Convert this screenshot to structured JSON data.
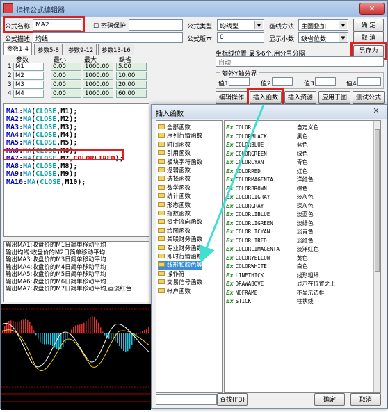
{
  "window": {
    "title": "指标公式编辑器",
    "close": "✕"
  },
  "form": {
    "name_label": "公式名称",
    "name_value": "MA2",
    "password_label": "密码保护",
    "type_label": "公式类型",
    "type_value": "均线型",
    "draw_label": "画线方法",
    "draw_value": "主图叠加",
    "ok": "确 定",
    "desc_label": "公式描述",
    "desc_value": "均线",
    "version_label": "公式版本",
    "version_value": "0",
    "decimal_label": "显示小数",
    "decimal_value": "缺省位数",
    "cancel": "取 消",
    "saveas": "另存为",
    "coord_label": "坐标线位置,最多6个,用分号分隔",
    "coord_value": "自动",
    "extra_axis_label": "额外Y轴分界",
    "values": [
      "值1",
      "值2",
      "值3",
      "值4"
    ],
    "btn_edit": "编辑操作",
    "btn_insert_func": "插入函数",
    "btn_insert_res": "插入资源",
    "btn_apply": "应用于图",
    "btn_test": "测试公式"
  },
  "tabs": [
    "参数1-4",
    "参数5-8",
    "参数9-12",
    "参数13-16"
  ],
  "params": {
    "headers": [
      "参数",
      "最小",
      "最大",
      "缺省"
    ],
    "rows": [
      {
        "idx": "1",
        "name": "M1",
        "min": "0.00",
        "max": "1000.00",
        "def": "5.00"
      },
      {
        "idx": "2",
        "name": "M2",
        "min": "0.00",
        "max": "1000.00",
        "def": "10.00"
      },
      {
        "idx": "3",
        "name": "M3",
        "min": "0.00",
        "max": "1000.00",
        "def": "20.00"
      },
      {
        "idx": "4",
        "name": "M4",
        "min": "0.00",
        "max": "1000.00",
        "def": "60.00"
      }
    ]
  },
  "code": [
    {
      "var": "MA1",
      "arg": "M1",
      "extra": ""
    },
    {
      "var": "MA2",
      "arg": "M2",
      "extra": ""
    },
    {
      "var": "MA3",
      "arg": "M3",
      "extra": ""
    },
    {
      "var": "MA4",
      "arg": "M4",
      "extra": ""
    },
    {
      "var": "MA5",
      "arg": "M5",
      "extra": ""
    },
    {
      "var": "MA6",
      "arg": "M6",
      "extra": ""
    },
    {
      "var": "MA7",
      "arg": "M7",
      "extra": ",COLORLIRED"
    },
    {
      "var": "MA8",
      "arg": "M8",
      "extra": ""
    },
    {
      "var": "MA9",
      "arg": "M9",
      "extra": ""
    },
    {
      "var": "MA10",
      "arg": "M10",
      "extra": ""
    }
  ],
  "code_tokens": {
    "fn": "MA",
    "close": "CLOSE"
  },
  "output": [
    "输出MA1:收盘价的M1日简单移动平均",
    "输出均线:收盘价的M2日简单移动平均",
    "输出MA3:收盘价的M3日简单移动平均",
    "输出MA4:收盘价的M4日简单移动平均",
    "输出MA5:收盘价的M5日简单移动平均",
    "输出MA6:收盘价的M6日简单移动平均",
    "输出MA7:收盘价的M7日简单移动平均,画淡红色"
  ],
  "dialog": {
    "title": "插入函数",
    "categories": [
      "全部函数",
      "序列行情函数",
      "时间函数",
      "引用函数",
      "板块字符函数",
      "逻辑函数",
      "选择函数",
      "数学函数",
      "统计函数",
      "形态函数",
      "指数函数",
      "资金流向函数",
      "绘图函数",
      "关联财务函数",
      "专业财务函数",
      "即时行情函数",
      "线形和颜色等",
      "操作符",
      "交易信号函数",
      "帐户函数"
    ],
    "functions": [
      [
        "COLOR",
        "自定义色"
      ],
      [
        "COLORBLACK",
        "黑色"
      ],
      [
        "COLORBLUE",
        "蓝色"
      ],
      [
        "COLORGREEN",
        "绿色"
      ],
      [
        "COLORCYAN",
        "青色"
      ],
      [
        "COLORRED",
        "红色"
      ],
      [
        "COLORMAGENTA",
        "洋红色"
      ],
      [
        "COLORBROWN",
        "棕色"
      ],
      [
        "COLORLIGRAY",
        "淡灰色"
      ],
      [
        "COLORGRAY",
        "深灰色"
      ],
      [
        "COLORLIBLUE",
        "淡蓝色"
      ],
      [
        "COLORLIGREEN",
        "淡绿色"
      ],
      [
        "COLORLICYAN",
        "淡青色"
      ],
      [
        "COLORLIRED",
        "淡红色"
      ],
      [
        "COLORLIMAGENTA",
        "淡洋红色"
      ],
      [
        "COLORYELLOW",
        "黄色"
      ],
      [
        "COLORWHITE",
        "白色"
      ],
      [
        "LINETHICK",
        "线形粗细"
      ],
      [
        "DRAWABOVE",
        "显示在位置之上"
      ],
      [
        "NOFRAME",
        "不显示边框"
      ],
      [
        "STICK",
        "柱状线"
      ]
    ],
    "find": "查找(F3)",
    "ok": "确定",
    "cancel": "取消"
  },
  "colors": {
    "accent": "#e02020",
    "selection": "#3a8fd8",
    "arrow": "#40e0d0"
  }
}
